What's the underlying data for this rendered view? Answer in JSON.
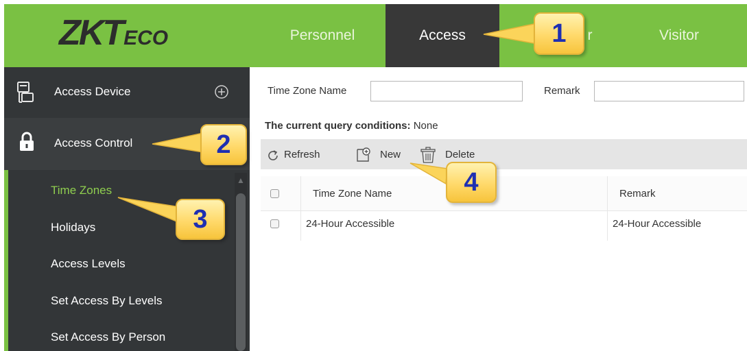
{
  "brand": {
    "logo_main": "ZKT",
    "logo_suffix": "ECO"
  },
  "nav": {
    "tabs": [
      {
        "label": "Personnel",
        "active": false
      },
      {
        "label": "Access",
        "active": true
      },
      {
        "label": "r",
        "active": false
      },
      {
        "label": "Visitor",
        "active": false
      }
    ]
  },
  "sidebar": {
    "sections": [
      {
        "label": "Access Device",
        "icon": "device-icon",
        "action": "plus-circle-icon"
      },
      {
        "label": "Access Control",
        "icon": "lock-icon"
      }
    ],
    "items": [
      {
        "label": "Time Zones",
        "active": true
      },
      {
        "label": "Holidays"
      },
      {
        "label": "Access Levels"
      },
      {
        "label": "Set Access By Levels"
      },
      {
        "label": "Set Access By Person"
      }
    ]
  },
  "search": {
    "time_zone_name_label": "Time Zone Name",
    "time_zone_name_value": "",
    "remark_label": "Remark",
    "remark_value": "",
    "query_conditions_label": "The current query conditions:",
    "query_conditions_value": "None"
  },
  "toolbar": {
    "refresh_label": "Refresh",
    "new_label": "New",
    "delete_label": "Delete"
  },
  "table": {
    "columns": [
      "Time Zone Name",
      "Remark"
    ],
    "rows": [
      {
        "name": "24-Hour Accessible",
        "remark": "24-Hour Accessible"
      }
    ]
  },
  "callouts": [
    "1",
    "2",
    "3",
    "4"
  ],
  "colors": {
    "brand_green": "#7ac143",
    "sidebar_dark": "#333638",
    "callout_text": "#1e2fb2"
  }
}
